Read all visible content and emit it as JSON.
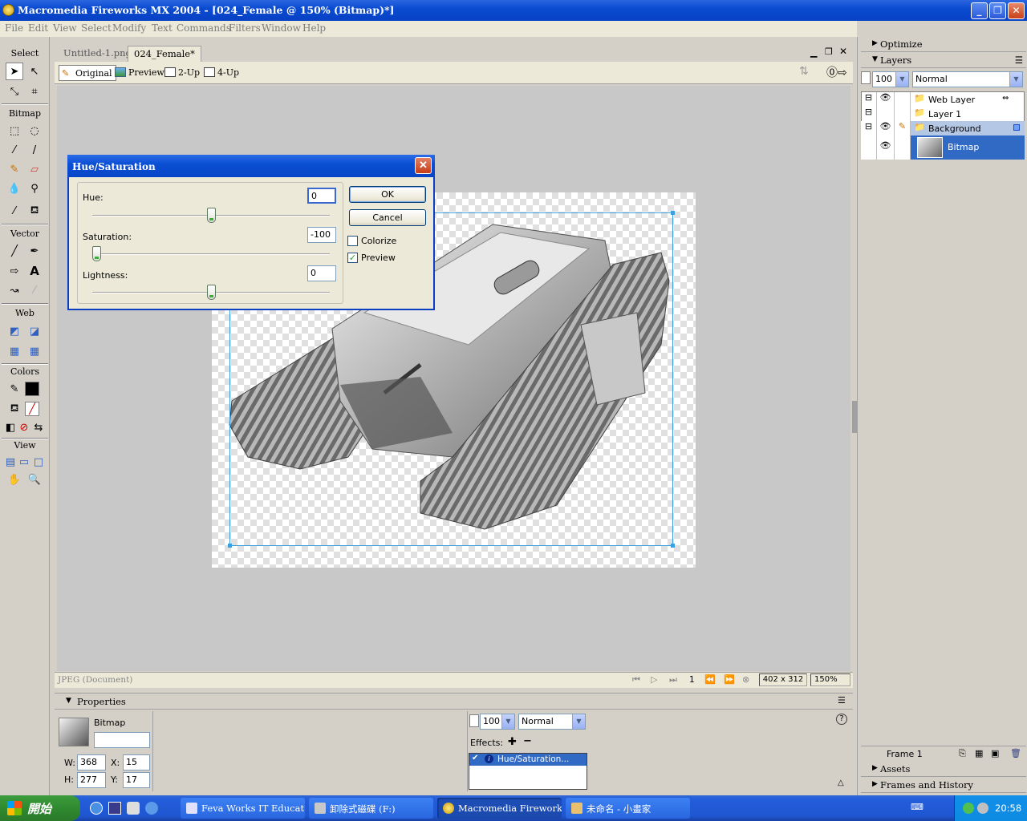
{
  "window": {
    "title": "Macromedia Fireworks MX 2004 - [024_Female @ 150% (Bitmap)*]"
  },
  "menu": [
    "File",
    "Edit",
    "View",
    "Select",
    "Modify",
    "Text",
    "Commands",
    "Filters",
    "Window",
    "Help"
  ],
  "toolbox": {
    "sections": [
      "Select",
      "Bitmap",
      "Vector",
      "Web",
      "Colors",
      "View"
    ]
  },
  "document": {
    "tabs": [
      "Untitled-1.png*",
      "024_Female*"
    ],
    "views": [
      "Original",
      "Preview",
      "2-Up",
      "4-Up"
    ],
    "status_left": "JPEG (Document)",
    "frame": "1",
    "size": "402 x 312",
    "zoom": "150%"
  },
  "dialog": {
    "title": "Hue/Saturation",
    "hue_label": "Hue:",
    "hue_value": "0",
    "hue_level": 0.5,
    "saturation_label": "Saturation:",
    "saturation_value": "-100",
    "saturation_level": 0,
    "lightness_label": "Lightness:",
    "lightness_value": "0",
    "lightness_level": 0.5,
    "ok": "OK",
    "cancel": "Cancel",
    "colorize": "Colorize",
    "preview": "Preview"
  },
  "panels": {
    "optimize": "Optimize",
    "layers": "Layers",
    "opacity": "100",
    "blend": "Normal",
    "layer_rows": [
      {
        "name": "Web Layer"
      },
      {
        "name": "Layer 1"
      },
      {
        "name": "Background"
      },
      {
        "name": "Bitmap"
      }
    ],
    "frame": "Frame 1",
    "assets": "Assets",
    "frames_history": "Frames and History"
  },
  "properties": {
    "title": "Properties",
    "object_type": "Bitmap",
    "w_label": "W:",
    "w": "368",
    "h_label": "H:",
    "h": "277",
    "x_label": "X:",
    "x": "15",
    "y_label": "Y:",
    "y": "17",
    "opacity": "100",
    "blend": "Normal",
    "effects_label": "Effects:",
    "effect_item": "Hue/Saturation..."
  },
  "taskbar": {
    "start": "開始",
    "tasks": [
      "Feva Works IT Educat...",
      "卸除式磁碟 (F:)",
      "Macromedia Fireworks...",
      "未命名 - 小畫家"
    ],
    "clock": "20:58"
  },
  "colors": {
    "xp_blue": "#0a4bd0",
    "selection": "#b4c8e6",
    "start_green": "#2f8a2f"
  }
}
